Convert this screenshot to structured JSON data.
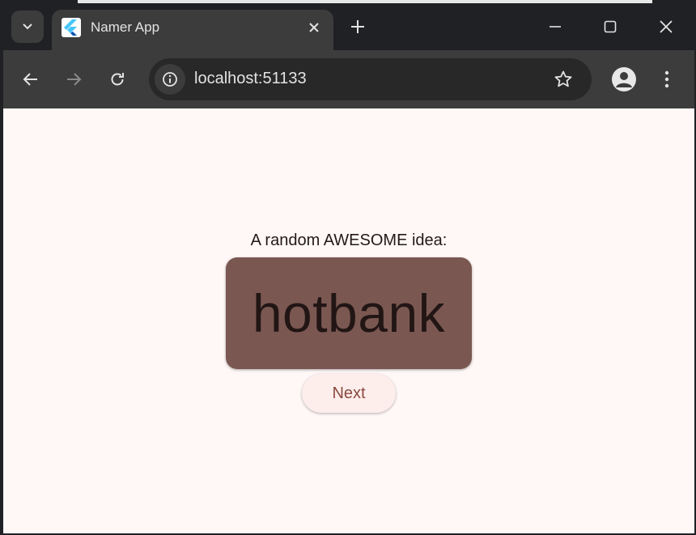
{
  "browser": {
    "tab": {
      "title": "Namer App",
      "favicon": "flutter-icon"
    },
    "address_bar": {
      "url": "localhost:51133"
    },
    "icons": {
      "tab_search": "chevron-down-icon",
      "tab_close": "close-icon",
      "new_tab": "plus-icon",
      "minimize": "minimize-icon",
      "maximize": "maximize-icon",
      "close_window": "close-icon",
      "back": "arrow-left-icon",
      "forward": "arrow-right-icon",
      "reload": "reload-icon",
      "site_info": "info-icon",
      "bookmark": "star-icon",
      "profile": "person-icon",
      "menu": "more-vertical-icon"
    },
    "colors": {
      "frame": "#202124",
      "toolbar": "#3c3c3c",
      "omnibox": "#282828",
      "text": "#e3e3e3"
    }
  },
  "app": {
    "caption": "A random AWESOME idea:",
    "word": "hotbank",
    "next_button_label": "Next",
    "colors": {
      "background": "#fff8f7",
      "card": "#7a5851",
      "button_bg": "#fdeeec",
      "button_text": "#8a4a3f"
    }
  }
}
